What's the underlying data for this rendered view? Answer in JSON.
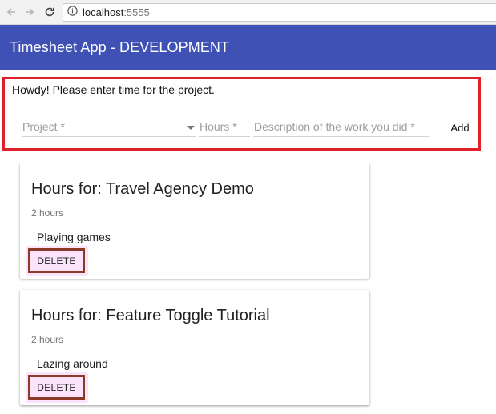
{
  "browser": {
    "url_host": "localhost",
    "url_port": ":5555"
  },
  "header": {
    "title": "Timesheet App - DEVELOPMENT",
    "background": "#3f51b5"
  },
  "form": {
    "greeting": "Howdy! Please enter time for the project.",
    "project_placeholder": "Project *",
    "hours_placeholder": "Hours *",
    "description_placeholder": "Description of the work you did *",
    "add_label": "Add",
    "highlight_color": "#e0202a"
  },
  "entries": [
    {
      "title": "Hours for: Travel Agency Demo",
      "hours": "2 hours",
      "description": "Playing games",
      "delete_label": "DELETE"
    },
    {
      "title": "Hours for: Feature Toggle Tutorial",
      "hours": "2 hours",
      "description": "Lazing around",
      "delete_label": "DELETE"
    }
  ],
  "icons": {
    "back": "arrow-left-icon",
    "forward": "arrow-right-icon",
    "reload": "reload-icon",
    "info": "info-icon",
    "dropdown": "caret-down-icon"
  }
}
